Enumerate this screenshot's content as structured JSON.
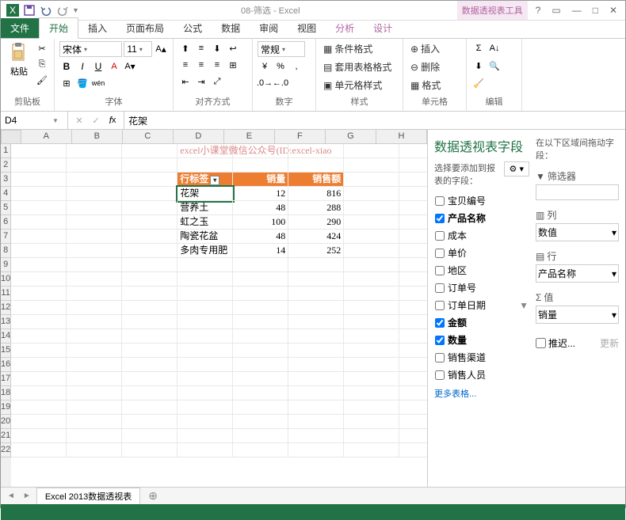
{
  "titlebar": {
    "title": "08-筛选 - Excel",
    "tools": "数据透视表工具"
  },
  "tabs": {
    "file": "文件",
    "home": "开始",
    "insert": "插入",
    "layout": "页面布局",
    "formula": "公式",
    "data": "数据",
    "review": "审阅",
    "view": "视图",
    "analyze": "分析",
    "design": "设计"
  },
  "ribbon": {
    "clipboard": {
      "paste": "粘贴",
      "label": "剪贴板"
    },
    "font": {
      "name": "宋体",
      "size": "11",
      "label": "字体"
    },
    "align": {
      "label": "对齐方式"
    },
    "number": {
      "general": "常规",
      "label": "数字"
    },
    "styles": {
      "cond": "条件格式",
      "table": "套用表格格式",
      "cell": "单元格样式",
      "label": "样式"
    },
    "cells": {
      "insert": "插入",
      "delete": "删除",
      "format": "格式",
      "label": "单元格"
    },
    "edit": {
      "label": "编辑"
    }
  },
  "namebox": "D4",
  "formula": "花架",
  "cols": [
    "A",
    "B",
    "C",
    "D",
    "E",
    "F",
    "G",
    "H"
  ],
  "watermark": "excel小课堂微信公众号(ID:excel-xiao",
  "pivot_header": {
    "rowlabel": "行标签",
    "qty": "销量",
    "amount": "销售额"
  },
  "pivot_rows": [
    {
      "label": "花架",
      "qty": "12",
      "amount": "816"
    },
    {
      "label": "营养土",
      "qty": "48",
      "amount": "288"
    },
    {
      "label": "虹之玉",
      "qty": "100",
      "amount": "290"
    },
    {
      "label": "陶瓷花盆",
      "qty": "48",
      "amount": "424"
    },
    {
      "label": "多肉专用肥",
      "qty": "14",
      "amount": "252"
    }
  ],
  "pane": {
    "title": "数据透视表字段",
    "choose": "选择要添加到报表的字段：",
    "drag": "在以下区域间拖动字段：",
    "fields": {
      "f1": "宝贝编号",
      "f2": "产品名称",
      "f3": "成本",
      "f4": "单价",
      "f5": "地区",
      "f6": "订单号",
      "f7": "订单日期",
      "f8": "金额",
      "f9": "数量",
      "f10": "销售渠道",
      "f11": "销售人员"
    },
    "more": "更多表格...",
    "filters": "筛选器",
    "cols": "列",
    "rows": "行",
    "values": "值",
    "colval": "数值",
    "rowval": "产品名称",
    "valval": "销量",
    "defer": "推迟...",
    "update": "更新"
  },
  "sheet": "Excel 2013数据透视表"
}
